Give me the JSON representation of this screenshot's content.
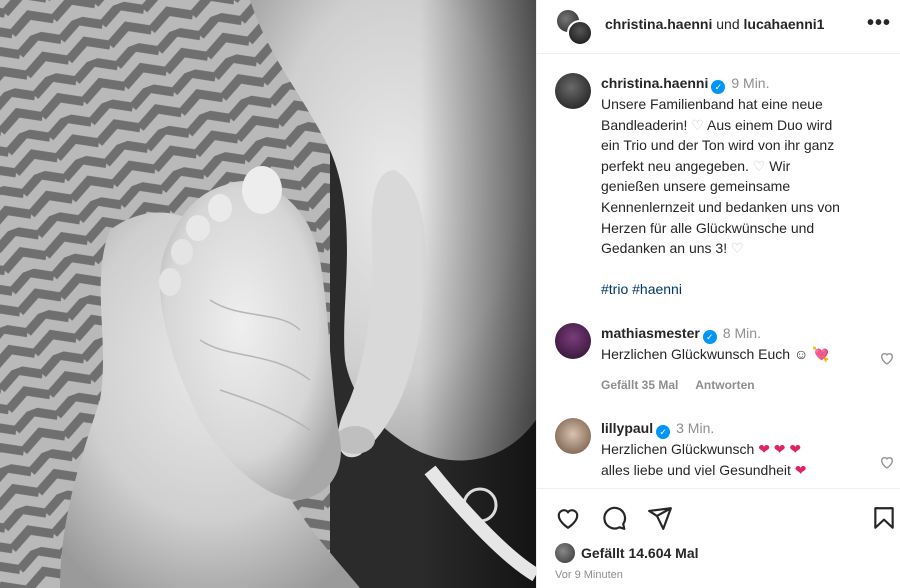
{
  "header": {
    "user1": "christina.haenni",
    "joiner": "und",
    "user2": "lucahaenni1",
    "more_icon": "more-horizontal-icon"
  },
  "post": {
    "username": "christina.haenni",
    "time": "9 Min.",
    "line1": "Unsere Familienband hat eine neue",
    "line2a": "Bandleaderin!",
    "line2b": "Aus einem Duo wird",
    "line3": "ein Trio und der Ton wird von ihr ganz",
    "line4a": "perfekt neu angegeben.",
    "line4b": "Wir",
    "line5": "genießen unsere gemeinsame",
    "line6": "Kennenlernzeit und bedanken uns von",
    "line7": "Herzen für alle Glückwünsche und",
    "line8a": "Gedanken an uns 3!",
    "heart": "♡",
    "hashtags": "#trio #haenni"
  },
  "comments": [
    {
      "username": "mathiasmester",
      "time": "8 Min.",
      "text": "Herzlichen Glückwunsch Euch",
      "emoji": "☺ 💘",
      "likes": "Gefällt 35 Mal",
      "reply": "Antworten"
    },
    {
      "username": "lillypaul",
      "time": "3 Min.",
      "text1": "Herzlichen Glückwunsch",
      "hearts1": "❤ ❤ ❤",
      "text2": "alles liebe und viel Gesundheit",
      "hearts2": "❤"
    }
  ],
  "footer": {
    "likes_label": "Gefällt",
    "likes_count": "14.604 Mal",
    "ago": "Vor 9 Minuten"
  },
  "icons": {
    "like": "heart-outline-icon",
    "comment": "comment-icon",
    "share": "send-icon",
    "save": "bookmark-icon"
  },
  "colors": {
    "verified": "#0095f6",
    "hashtag": "#00376b",
    "muted": "#8e8e8e",
    "heart_red": "#e0245e"
  }
}
